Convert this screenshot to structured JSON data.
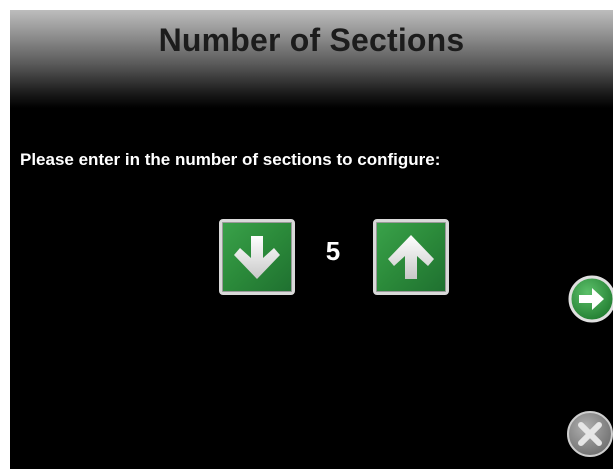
{
  "header": {
    "title": "Number of Sections"
  },
  "prompt": {
    "text": "Please enter in the number of sections to configure:"
  },
  "stepper": {
    "value": "5",
    "decrement_icon": "arrow-down-icon",
    "increment_icon": "arrow-up-icon"
  },
  "actions": {
    "next_icon": "arrow-right-circle-icon",
    "cancel_icon": "close-circle-icon"
  },
  "colors": {
    "accent_green": "#2b8a3a",
    "background": "#000000",
    "text": "#ffffff"
  }
}
